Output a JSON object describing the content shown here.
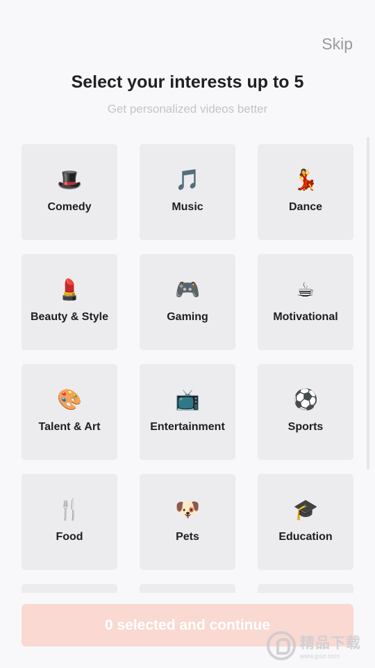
{
  "header": {
    "skip_label": "Skip",
    "title": "Select your interests up to 5",
    "subtitle": "Get personalized videos better"
  },
  "interests": [
    {
      "emoji": "🎩",
      "icon_name": "top-hat-icon",
      "label": "Comedy"
    },
    {
      "emoji": "🎵",
      "icon_name": "music-note-icon",
      "label": "Music"
    },
    {
      "emoji": "💃",
      "icon_name": "dancer-icon",
      "label": "Dance"
    },
    {
      "emoji": "💄",
      "icon_name": "lipstick-icon",
      "label": "Beauty & Style"
    },
    {
      "emoji": "🎮",
      "icon_name": "gamepad-icon",
      "label": "Gaming"
    },
    {
      "emoji": "☕",
      "icon_name": "coffee-icon",
      "label": "Motivational"
    },
    {
      "emoji": "🎨",
      "icon_name": "palette-icon",
      "label": "Talent & Art"
    },
    {
      "emoji": "📺",
      "icon_name": "television-icon",
      "label": "Entertainment"
    },
    {
      "emoji": "⚽",
      "icon_name": "soccer-ball-icon",
      "label": "Sports"
    },
    {
      "emoji": "🍴",
      "icon_name": "fork-knife-icon",
      "label": "Food"
    },
    {
      "emoji": "🐶",
      "icon_name": "dog-face-icon",
      "label": "Pets"
    },
    {
      "emoji": "🎓",
      "icon_name": "graduation-cap-icon",
      "label": "Education"
    },
    {
      "emoji": "",
      "icon_name": "",
      "label": ""
    },
    {
      "emoji": "",
      "icon_name": "",
      "label": ""
    },
    {
      "emoji": "",
      "icon_name": "",
      "label": ""
    }
  ],
  "footer": {
    "continue_label": "0 selected and continue"
  },
  "watermark": {
    "text": "精品下载",
    "url": "www.jpxz.com"
  },
  "colors": {
    "background": "#f8f8fa",
    "tile": "#ececee",
    "button_disabled": "#f9d9d1",
    "button_text": "#ffffff"
  }
}
